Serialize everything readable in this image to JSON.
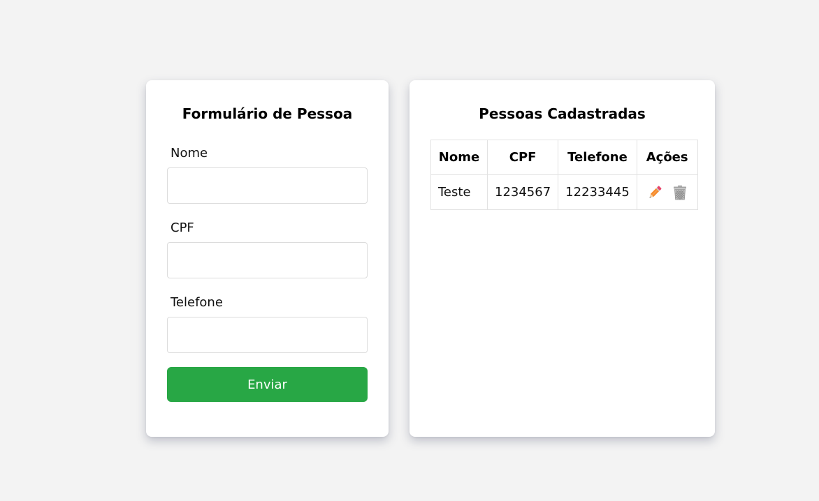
{
  "form": {
    "title": "Formulário de Pessoa",
    "fields": [
      {
        "label": "Nome",
        "value": "",
        "placeholder": ""
      },
      {
        "label": "CPF",
        "value": "",
        "placeholder": ""
      },
      {
        "label": "Telefone",
        "value": "",
        "placeholder": ""
      }
    ],
    "submit_label": "Enviar"
  },
  "list": {
    "title": "Pessoas Cadastradas",
    "columns": [
      "Nome",
      "CPF",
      "Telefone",
      "Ações"
    ],
    "rows": [
      {
        "nome": "Teste",
        "cpf": "1234567",
        "telefone": "12233445",
        "actions": [
          "pencil-icon",
          "trash-icon"
        ]
      }
    ]
  },
  "colors": {
    "background": "#f3f3f3",
    "card": "#ffffff",
    "accent_green": "#28a745",
    "pencil_orange": "#f58a2b",
    "pencil_tip_pink": "#e8456b",
    "trash_gray": "#a8a8a8"
  }
}
